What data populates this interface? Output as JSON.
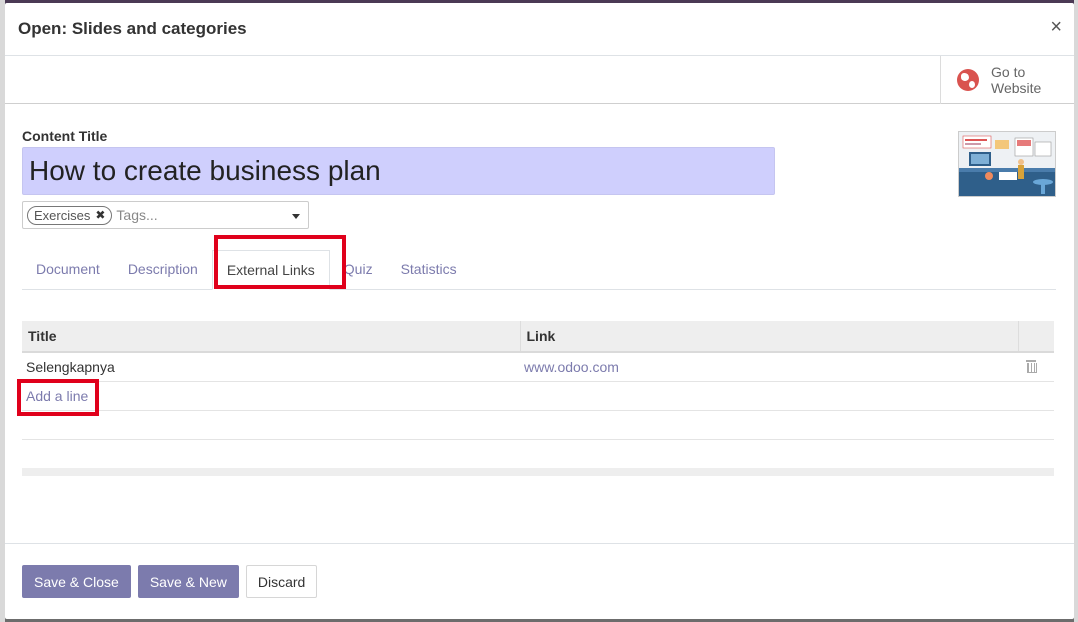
{
  "dialog": {
    "title": "Open: Slides and categories",
    "close_symbol": "×"
  },
  "button_box": {
    "go_to_website_label": "Go to Website",
    "icon": "globe-icon"
  },
  "form": {
    "content_title_label": "Content Title",
    "content_title_value": "How to create business plan",
    "tags": [
      "Exercises"
    ],
    "tags_placeholder": "Tags...",
    "thumbnail_alt": "Business plan slide thumbnail"
  },
  "tabs": [
    {
      "label": "Document",
      "active": false
    },
    {
      "label": "Description",
      "active": false
    },
    {
      "label": "External Links",
      "active": true
    },
    {
      "label": "Quiz",
      "active": false
    },
    {
      "label": "Statistics",
      "active": false
    }
  ],
  "links_table": {
    "columns": [
      "Title",
      "Link"
    ],
    "rows": [
      {
        "title": "Selengkapnya",
        "link": "www.odoo.com"
      }
    ],
    "add_line_label": "Add a line"
  },
  "footer": {
    "save_close_label": "Save & Close",
    "save_new_label": "Save & New",
    "discard_label": "Discard"
  },
  "colors": {
    "primary": "#7c7bad",
    "highlight": "#e0001b",
    "title_input_bg": "#cfcffd"
  }
}
